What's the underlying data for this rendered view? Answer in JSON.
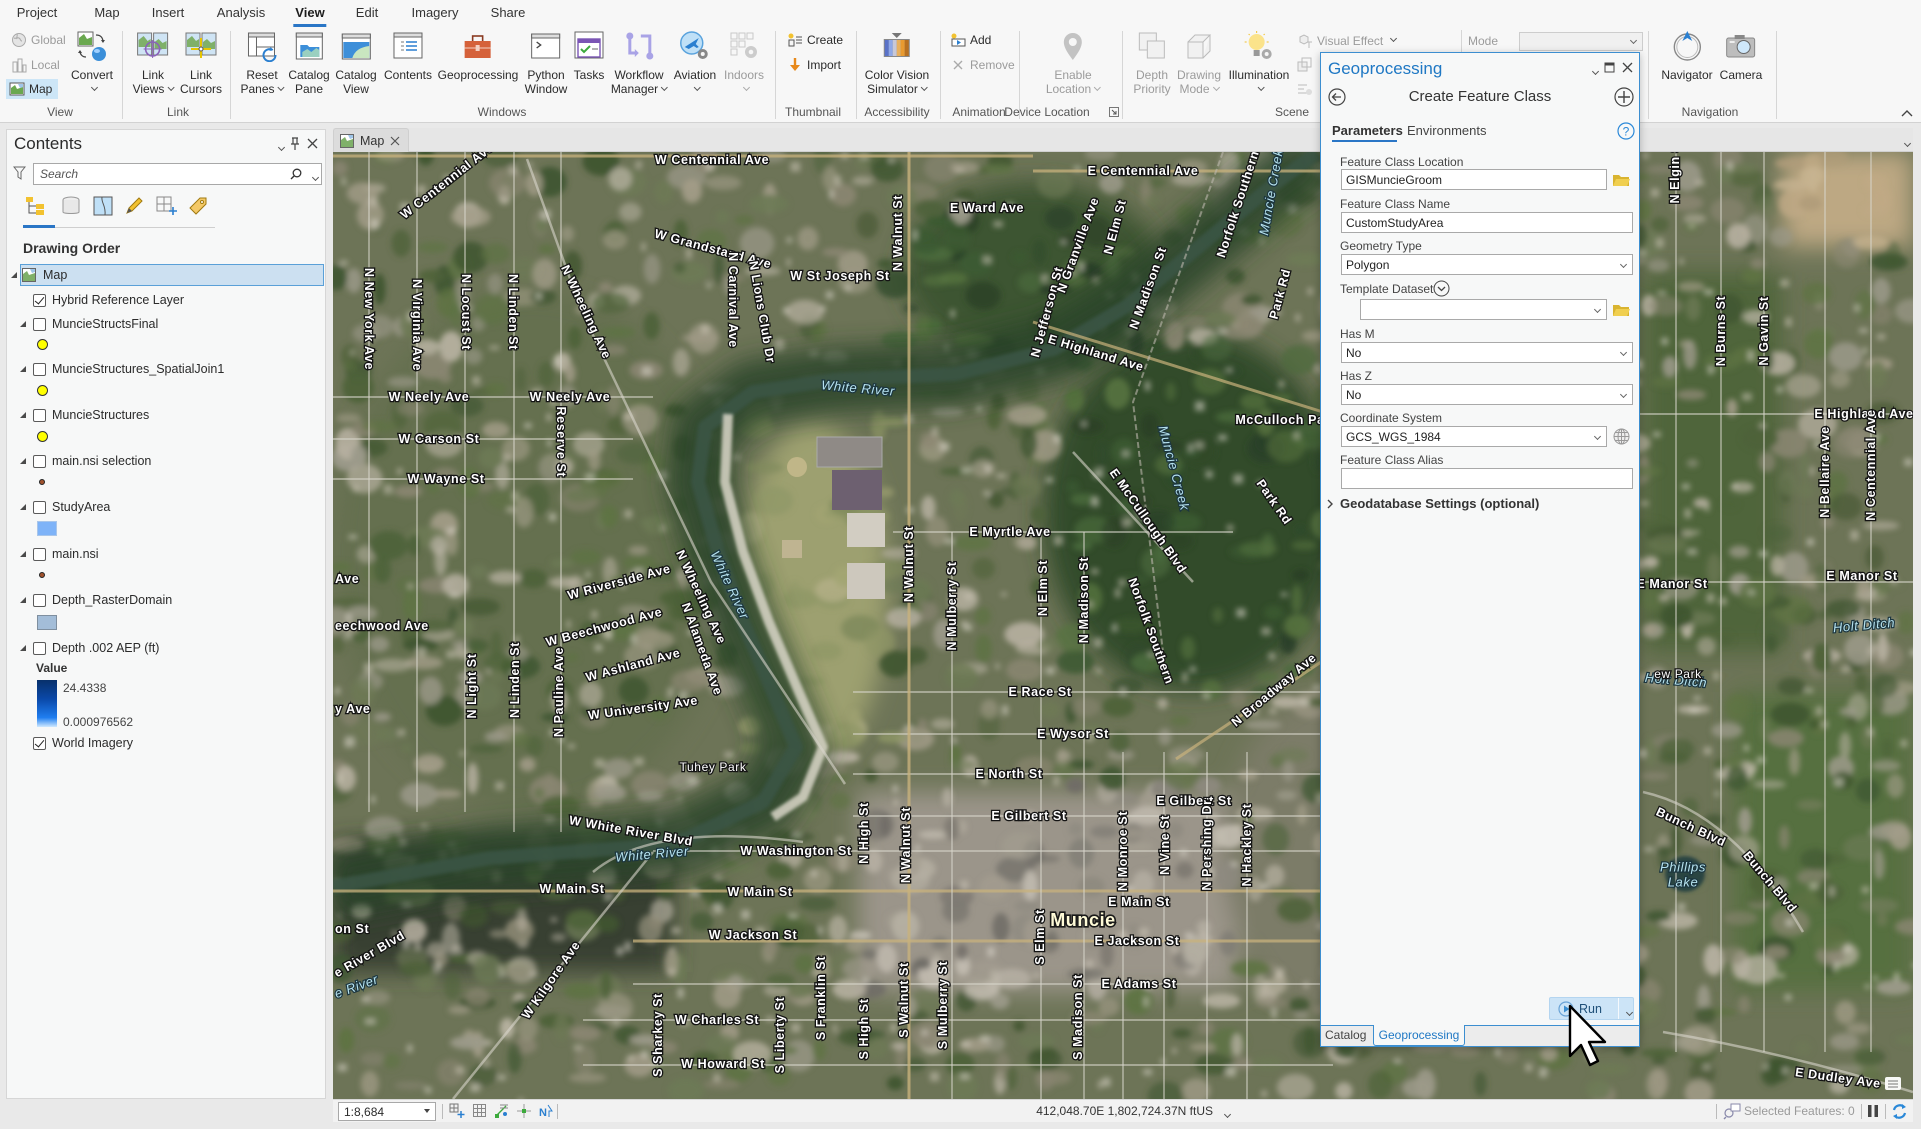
{
  "ribbon": {
    "tabs": [
      "Project",
      "Map",
      "Insert",
      "Analysis",
      "View",
      "Edit",
      "Imagery",
      "Share"
    ],
    "active_tab": "View",
    "groups": {
      "view": {
        "label": "View",
        "global": "Global",
        "local": "Local",
        "map": "Map",
        "convert": "Convert"
      },
      "link": {
        "label": "Link",
        "link_views": [
          "Link",
          "Views"
        ],
        "link_cursors": [
          "Link",
          "Cursors"
        ]
      },
      "windows": {
        "label": "Windows",
        "reset_panes": [
          "Reset",
          "Panes"
        ],
        "catalog_pane": [
          "Catalog",
          "Pane"
        ],
        "catalog_view": [
          "Catalog",
          "View"
        ],
        "contents": "Contents",
        "geoprocessing": "Geoprocessing",
        "python_window": [
          "Python",
          "Window"
        ],
        "tasks": "Tasks",
        "workflow_manager": [
          "Workflow",
          "Manager"
        ],
        "aviation": "Aviation",
        "indoors": "Indoors"
      },
      "thumbnail": {
        "label": "Thumbnail",
        "create": "Create",
        "import": "Import"
      },
      "accessibility": {
        "label": "Accessibility",
        "color_vision_simulator": [
          "Color Vision",
          "Simulator"
        ]
      },
      "animation": {
        "label": "Animation",
        "add": "Add",
        "remove": "Remove"
      },
      "device_location": {
        "label": "Device Location",
        "enable_location": [
          "Enable",
          "Location"
        ]
      },
      "scene": {
        "label": "Scene",
        "depth_priority": [
          "Depth",
          "Priority"
        ],
        "drawing_mode": [
          "Drawing",
          "Mode"
        ],
        "illumination": "Illumination",
        "visual_effect": "Visual Effect",
        "mode_label": "Mode",
        "mode_value": ""
      },
      "navigation": {
        "label": "Navigation",
        "navigator": "Navigator",
        "camera": "Camera"
      }
    }
  },
  "contents": {
    "title": "Contents",
    "search_placeholder": "Search",
    "section_title": "Drawing Order",
    "map_item": "Map",
    "layers": [
      {
        "name": "Hybrid Reference Layer",
        "visible": true
      },
      {
        "name": "MuncieStructsFinal",
        "visible": false,
        "symbol_color": "#ffff00"
      },
      {
        "name": "MuncieStructures_SpatialJoin1",
        "visible": false,
        "symbol_color": "#ffff00"
      },
      {
        "name": "MuncieStructures",
        "visible": false,
        "symbol_color": "#ffff00"
      },
      {
        "name": "main.nsi selection",
        "visible": false,
        "symbol_color": "#a0522d"
      },
      {
        "name": "StudyArea",
        "visible": false,
        "symbol_color": "#7eb3f8"
      },
      {
        "name": "main.nsi",
        "visible": false,
        "symbol_color": "#a0522d"
      },
      {
        "name": "Depth_RasterDomain",
        "visible": false,
        "symbol_color": "#a3bdd8"
      },
      {
        "name": "Depth .002 AEP (ft)",
        "visible": false
      },
      {
        "name": "World Imagery",
        "visible": true
      }
    ],
    "depth_legend": {
      "title": "Value",
      "high": "24.4338",
      "low": "0.000976562",
      "high_color": "#08306b",
      "low_color": "#cfe9ff"
    }
  },
  "map_view": {
    "tab_label": "Map",
    "labels": [
      {
        "text": "W Centennial Ave",
        "kind": "street"
      },
      {
        "text": "W Centennial Ave",
        "kind": "street"
      },
      {
        "text": "E Centennial Ave",
        "kind": "street"
      },
      {
        "text": "W Grandstand Ave",
        "kind": "street"
      },
      {
        "text": "W St Joseph St",
        "kind": "street"
      },
      {
        "text": "E Ward Ave",
        "kind": "street"
      },
      {
        "text": "N Walnut St",
        "kind": "street"
      },
      {
        "text": "N Wheeling Ave",
        "kind": "street"
      },
      {
        "text": "N Carnival Ave",
        "kind": "street"
      },
      {
        "text": "N Lions Club Dr",
        "kind": "street"
      },
      {
        "text": "N New York Ave",
        "kind": "street"
      },
      {
        "text": "N Virginia Ave",
        "kind": "street"
      },
      {
        "text": "N Locust St",
        "kind": "street"
      },
      {
        "text": "N Linden St",
        "kind": "street"
      },
      {
        "text": "N Reserve St",
        "kind": "street"
      },
      {
        "text": "W Neely Ave",
        "kind": "street"
      },
      {
        "text": "W Neely Ave",
        "kind": "street"
      },
      {
        "text": "W Carson St",
        "kind": "street"
      },
      {
        "text": "W Wayne St",
        "kind": "street"
      },
      {
        "text": "White River",
        "kind": "water"
      },
      {
        "text": "E Highland Ave",
        "kind": "street"
      },
      {
        "text": "N Jefferson St",
        "kind": "street"
      },
      {
        "text": "N Madison St",
        "kind": "street"
      },
      {
        "text": "N Elm St",
        "kind": "street"
      },
      {
        "text": "N Granville Ave",
        "kind": "street"
      },
      {
        "text": "Norfolk Southern",
        "kind": "street"
      },
      {
        "text": "Muncie Creek",
        "kind": "water"
      },
      {
        "text": "Park Rd",
        "kind": "street"
      },
      {
        "text": "McCulloch Pa",
        "kind": "street"
      },
      {
        "text": "Muncie Creek",
        "kind": "water"
      },
      {
        "text": "E McCullough Blvd",
        "kind": "street"
      },
      {
        "text": "Park Rd",
        "kind": "street"
      },
      {
        "text": "E Myrtle Ave",
        "kind": "street"
      },
      {
        "text": "N Walnut St",
        "kind": "street"
      },
      {
        "text": "N Mulberry St",
        "kind": "street"
      },
      {
        "text": "N Elm St",
        "kind": "street"
      },
      {
        "text": "N Madison St",
        "kind": "street"
      },
      {
        "text": "Norfolk Southern",
        "kind": "street"
      },
      {
        "text": "N Broadway Ave",
        "kind": "street"
      },
      {
        "text": "E Race St",
        "kind": "street"
      },
      {
        "text": "E Wysor St",
        "kind": "street"
      },
      {
        "text": "E North St",
        "kind": "street"
      },
      {
        "text": "E Gilbert St",
        "kind": "street"
      },
      {
        "text": "E Gilbert St",
        "kind": "street"
      },
      {
        "text": "W Riverside Ave",
        "kind": "street"
      },
      {
        "text": "W Beechwood Ave",
        "kind": "street"
      },
      {
        "text": "W Ashland Ave",
        "kind": "street"
      },
      {
        "text": "W University Ave",
        "kind": "street"
      },
      {
        "text": "N Wheeling Ave",
        "kind": "street"
      },
      {
        "text": "N Alameda Ave",
        "kind": "street"
      },
      {
        "text": "White River",
        "kind": "water"
      },
      {
        "text": "Tuhey Park",
        "kind": "park"
      },
      {
        "text": "W White River Blvd",
        "kind": "street"
      },
      {
        "text": "White River",
        "kind": "water"
      },
      {
        "text": "W Washington St",
        "kind": "street"
      },
      {
        "text": "W Main St",
        "kind": "street"
      },
      {
        "text": "W Main St",
        "kind": "street"
      },
      {
        "text": "E Main St",
        "kind": "street"
      },
      {
        "text": "Muncie",
        "kind": "city"
      },
      {
        "text": "W Jackson St",
        "kind": "street"
      },
      {
        "text": "E Jackson St",
        "kind": "street"
      },
      {
        "text": "E Adams St",
        "kind": "street"
      },
      {
        "text": "W Kilgore Ave",
        "kind": "street"
      },
      {
        "text": "W Charles St",
        "kind": "street"
      },
      {
        "text": "W Howard St",
        "kind": "street"
      },
      {
        "text": "N Elgin St",
        "kind": "street"
      },
      {
        "text": "N Burns St",
        "kind": "street"
      },
      {
        "text": "N Gavin St",
        "kind": "street"
      },
      {
        "text": "E Highland Ave",
        "kind": "street"
      },
      {
        "text": "N Bellaire Ave",
        "kind": "street"
      },
      {
        "text": "N Centennial Ave",
        "kind": "street"
      },
      {
        "text": "E Manor St",
        "kind": "street"
      },
      {
        "text": "E Manor St",
        "kind": "street"
      },
      {
        "text": "Holt Ditch",
        "kind": "water"
      },
      {
        "text": "Holt Ditch",
        "kind": "water"
      },
      {
        "text": "Bunch Blvd",
        "kind": "street"
      },
      {
        "text": "Bunch Blvd",
        "kind": "street"
      },
      {
        "text": "Phillips",
        "kind": "water"
      },
      {
        "text": "Lake",
        "kind": "water"
      },
      {
        "text": "E Dudley Ave",
        "kind": "street"
      },
      {
        "text": "S Elm St",
        "kind": "street"
      },
      {
        "text": "N Linden St",
        "kind": "street"
      },
      {
        "text": "N Pauline Ave",
        "kind": "street"
      },
      {
        "text": "N Light St",
        "kind": "street"
      },
      {
        "text": "S Walnut St",
        "kind": "street"
      },
      {
        "text": "S High St",
        "kind": "street"
      },
      {
        "text": "S Franklin St",
        "kind": "street"
      },
      {
        "text": "S Mulberry St",
        "kind": "street"
      },
      {
        "text": "S Madison St",
        "kind": "street"
      },
      {
        "text": "S Liberty St",
        "kind": "street"
      },
      {
        "text": "S Sharkey St",
        "kind": "street"
      },
      {
        "text": "N Pershing Dr",
        "kind": "street"
      },
      {
        "text": "N Hackley St",
        "kind": "street"
      },
      {
        "text": "N Vine St",
        "kind": "street"
      },
      {
        "text": "N Monroe St",
        "kind": "street"
      },
      {
        "text": "N High St",
        "kind": "street"
      },
      {
        "text": "N Walnut St",
        "kind": "street"
      },
      {
        "text": "Ave",
        "kind": "street"
      },
      {
        "text": "eechwood Ave",
        "kind": "street"
      },
      {
        "text": "y Ave",
        "kind": "street"
      },
      {
        "text": "on St",
        "kind": "street"
      },
      {
        "text": "e River Blvd",
        "kind": "street"
      },
      {
        "text": "e River",
        "kind": "water"
      },
      {
        "text": "ew Park",
        "kind": "park"
      }
    ]
  },
  "status_bar": {
    "scale": "1:8,684",
    "coordinates": "412,048.70E 1,802,724.37N ftUS",
    "selected_features": "Selected Features: 0"
  },
  "geoprocessing": {
    "pane_title": "Geoprocessing",
    "tool_title": "Create Feature Class",
    "tabs": [
      "Parameters",
      "Environments"
    ],
    "active_tab": "Parameters",
    "fields": {
      "location": {
        "label": "Feature Class Location",
        "value": "GISMuncieGroom"
      },
      "name": {
        "label": "Feature Class Name",
        "value": "CustomStudyArea"
      },
      "geometry_type": {
        "label": "Geometry Type",
        "value": "Polygon"
      },
      "template_dataset": {
        "label": "Template Dataset",
        "value": ""
      },
      "has_m": {
        "label": "Has M",
        "value": "No"
      },
      "has_z": {
        "label": "Has Z",
        "value": "No"
      },
      "coordinate_system": {
        "label": "Coordinate System",
        "value": "GCS_WGS_1984"
      },
      "alias": {
        "label": "Feature Class Alias",
        "value": ""
      }
    },
    "geodatabase_settings": "Geodatabase Settings (optional)",
    "run_label": "Run",
    "bottom_tabs": [
      "Catalog",
      "Geoprocessing"
    ],
    "active_bottom_tab": "Geoprocessing",
    "accent_color": "#1f78c4"
  }
}
